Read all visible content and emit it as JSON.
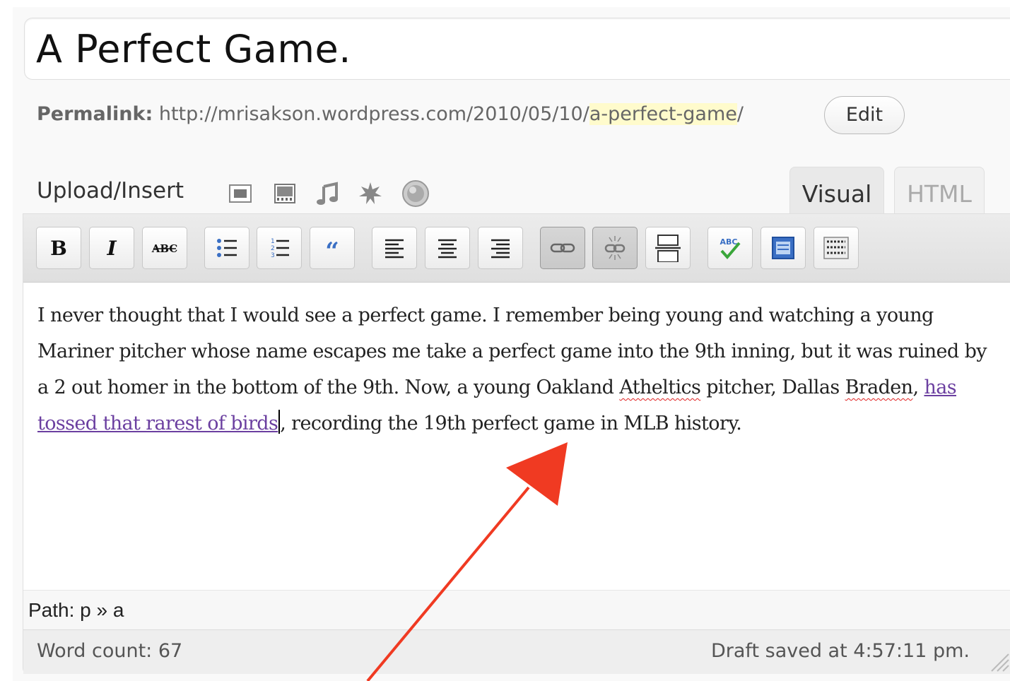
{
  "post": {
    "title": "A Perfect Game."
  },
  "permalink": {
    "label": "Permalink:",
    "base_url": "http://mrisakson.wordpress.com/2010/05/10/",
    "slug": "a-perfect-game",
    "trailing": "/",
    "edit_label": "Edit"
  },
  "media": {
    "label": "Upload/Insert",
    "icons": [
      "add-image-icon",
      "add-video-icon",
      "add-audio-icon",
      "add-media-icon",
      "add-poll-icon"
    ]
  },
  "tabs": {
    "visual": "Visual",
    "html": "HTML",
    "active": "Visual"
  },
  "toolbar": {
    "buttons": [
      "bold",
      "italic",
      "strikethrough",
      "unordered-list",
      "ordered-list",
      "blockquote",
      "align-left",
      "align-center",
      "align-right",
      "insert-link",
      "unlink",
      "insert-more",
      "spellcheck",
      "fullscreen",
      "kitchen-sink"
    ],
    "active": [
      "insert-link",
      "unlink"
    ]
  },
  "content": {
    "part1": "I never thought that I would see a perfect game. I remember being young and watching a young Mariner pitcher whose name escapes me take a perfect game into the 9th inning, but it was ruined by a 2 out homer in the bottom of the 9th. Now, a young Oakland ",
    "misspelled1": "Atheltics",
    "part2": " pitcher, Dallas ",
    "misspelled2": "Braden",
    "part3": ", ",
    "link_text": "has tossed that rarest of birds",
    "part4": ", recording the 19th perfect game in MLB history."
  },
  "path": {
    "text": "Path: p » a"
  },
  "status": {
    "word_count": "Word count: 67",
    "draft_saved": "Draft saved at 4:57:11 pm."
  },
  "colors": {
    "link": "#6b3fa0",
    "annotation_arrow": "#f03a22",
    "slug_highlight": "#fffbcc"
  }
}
